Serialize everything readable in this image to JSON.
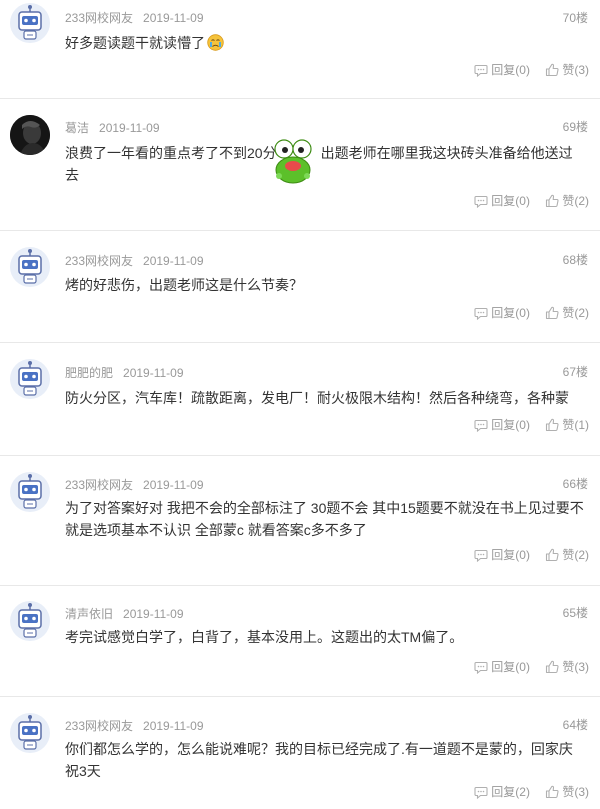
{
  "actions": {
    "reply_label": "回复",
    "like_label": "赞"
  },
  "comments": [
    {
      "author": "233网校网友",
      "date": "2019-11-09",
      "floor": "70楼",
      "content": "好多题读题干就读懵了",
      "reply_count": "(0)",
      "like_count": "(3)"
    },
    {
      "author": "葛洁",
      "date": "2019-11-09",
      "floor": "69楼",
      "content_a": "浪费了一年看的重点考了不到20分",
      "content_b": "出题老师在哪里我这块砖头准备给他送过去",
      "reply_count": "(0)",
      "like_count": "(2)"
    },
    {
      "author": "233网校网友",
      "date": "2019-11-09",
      "floor": "68楼",
      "content": "烤的好悲伤，出题老师这是什么节奏？",
      "reply_count": "(0)",
      "like_count": "(2)"
    },
    {
      "author": "肥肥的肥",
      "date": "2019-11-09",
      "floor": "67楼",
      "content": "防火分区，汽车库！疏散距离，发电厂！耐火极限木结构！然后各种绕弯，各种蒙",
      "reply_count": "(0)",
      "like_count": "(1)"
    },
    {
      "author": "233网校网友",
      "date": "2019-11-09",
      "floor": "66楼",
      "content": "为了对答案好对 我把不会的全部标注了 30题不会 其中15题要不就没在书上见过要不就是选项基本不认识 全部蒙c 就看答案c多不多了",
      "reply_count": "(0)",
      "like_count": "(2)"
    },
    {
      "author": "清声依旧",
      "date": "2019-11-09",
      "floor": "65楼",
      "content": "考完试感觉白学了，白背了，基本没用上。这题出的太TM偏了。",
      "reply_count": "(0)",
      "like_count": "(3)"
    },
    {
      "author": "233网校网友",
      "date": "2019-11-09",
      "floor": "64楼",
      "content": "你们都怎么学的，怎么能说难呢？我的目标已经完成了.有一道题不是蒙的，回家庆祝3天",
      "reply_count": "(2)",
      "like_count": "(3)"
    }
  ]
}
